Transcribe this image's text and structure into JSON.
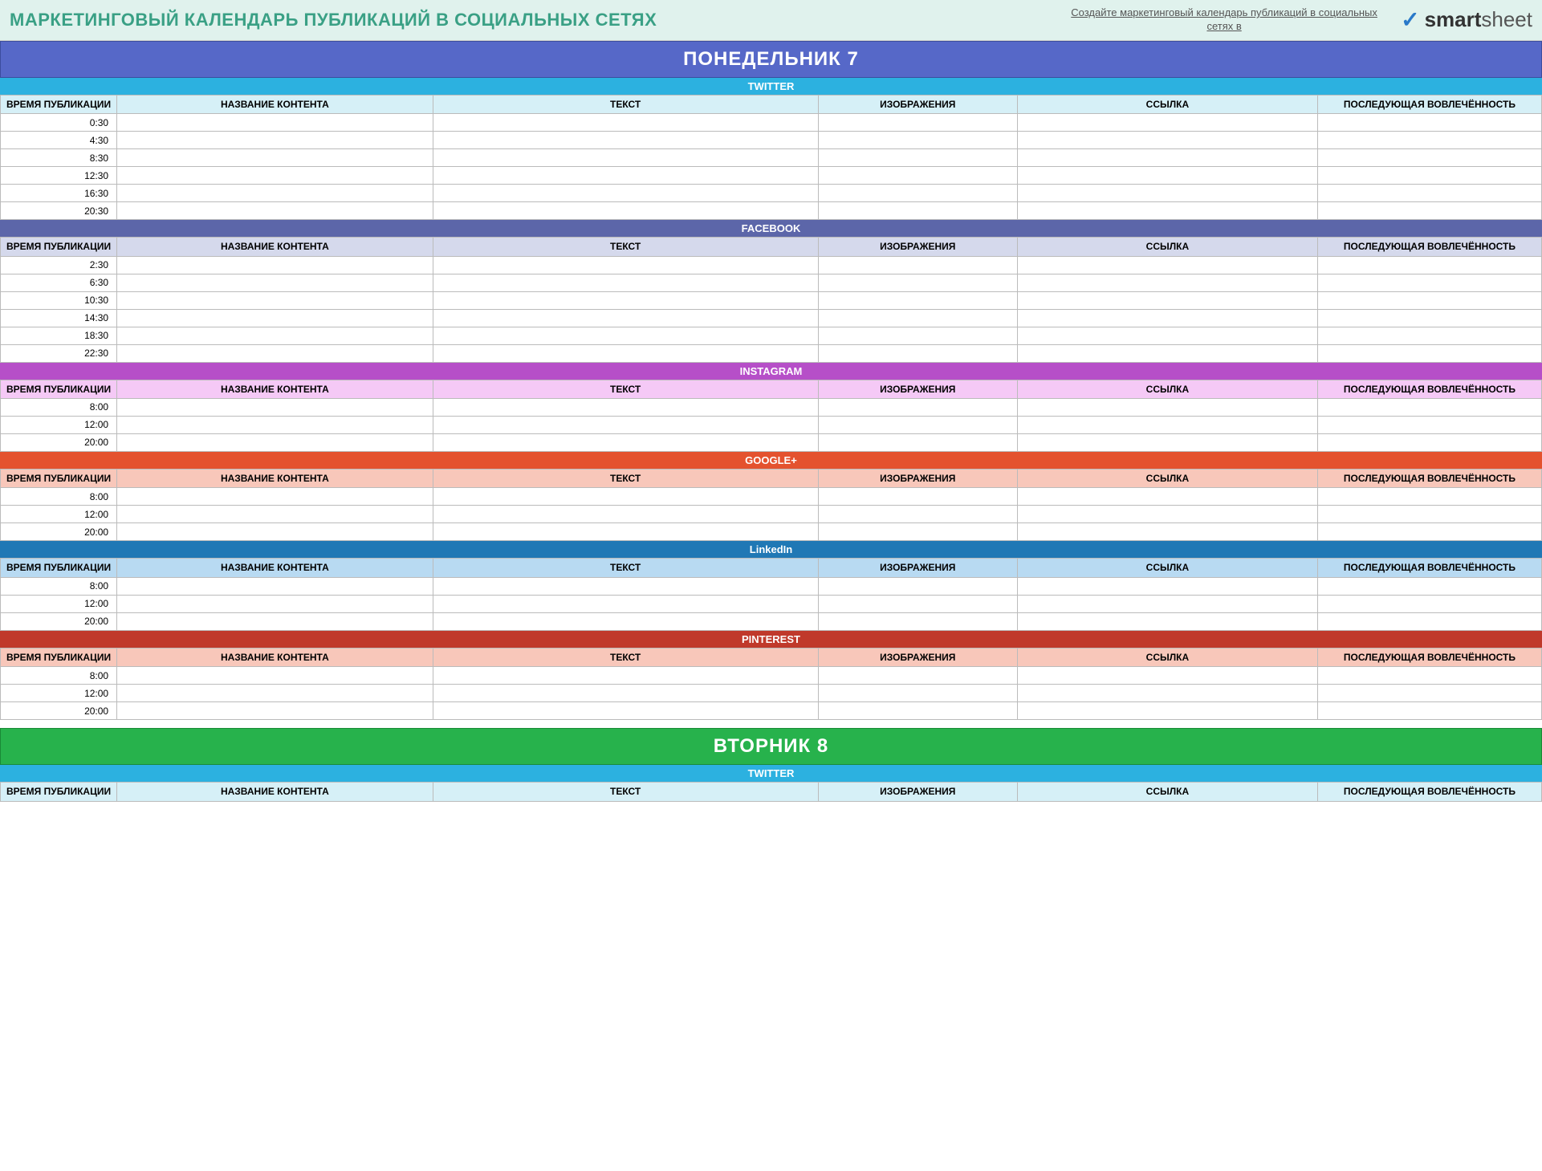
{
  "header": {
    "title": "МАРКЕТИНГОВЫЙ КАЛЕНДАРЬ ПУБЛИКАЦИЙ В СОЦИАЛЬНЫХ СЕТЯХ",
    "link_text": "Создайте маркетинговый календарь публикаций в социальных сетях в",
    "brand_prefix": "smart",
    "brand_suffix": "sheet"
  },
  "columns": {
    "time": "ВРЕМЯ ПУБЛИКАЦИИ",
    "content": "НАЗВАНИЕ КОНТЕНТА",
    "text": "ТЕКСТ",
    "images": "ИЗОБРАЖЕНИЯ",
    "link": "ССЫЛКА",
    "engagement": "ПОСЛЕДУЮЩАЯ ВОВЛЕЧЁННОСТЬ"
  },
  "days": [
    {
      "label": "ПОНЕДЕЛЬНИК   7",
      "day_class": "day-monday",
      "platforms": [
        {
          "name": "TWITTER",
          "p_class": "p-twitter",
          "h_class": "h-twitter",
          "times": [
            "0:30",
            "4:30",
            "8:30",
            "12:30",
            "16:30",
            "20:30"
          ]
        },
        {
          "name": "FACEBOOK",
          "p_class": "p-facebook",
          "h_class": "h-facebook",
          "times": [
            "2:30",
            "6:30",
            "10:30",
            "14:30",
            "18:30",
            "22:30"
          ]
        },
        {
          "name": "INSTAGRAM",
          "p_class": "p-instagram",
          "h_class": "h-instagram",
          "times": [
            "8:00",
            "12:00",
            "20:00"
          ]
        },
        {
          "name": "GOOGLE+",
          "p_class": "p-google",
          "h_class": "h-google",
          "times": [
            "8:00",
            "12:00",
            "20:00"
          ]
        },
        {
          "name": "LinkedIn",
          "p_class": "p-linkedin",
          "h_class": "h-linkedin",
          "times": [
            "8:00",
            "12:00",
            "20:00"
          ]
        },
        {
          "name": "PINTEREST",
          "p_class": "p-pinterest",
          "h_class": "h-pinterest",
          "times": [
            "8:00",
            "12:00",
            "20:00"
          ]
        }
      ]
    },
    {
      "label": "ВТОРНИК   8",
      "day_class": "day-tuesday",
      "platforms": [
        {
          "name": "TWITTER",
          "p_class": "p-twitter",
          "h_class": "h-twitter",
          "times": []
        }
      ]
    }
  ]
}
